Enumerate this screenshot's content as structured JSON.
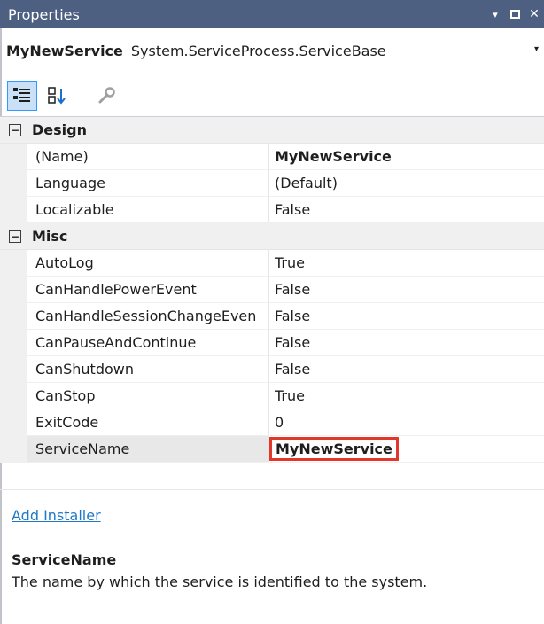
{
  "window": {
    "title": "Properties",
    "controls": {
      "dropdown": "▾",
      "close": "✕"
    }
  },
  "object_selector": {
    "name": "MyNewService",
    "type": "System.ServiceProcess.ServiceBase",
    "dropdown": "▾"
  },
  "toolbar": {
    "buttons": [
      {
        "icon": "categorized-icon",
        "active": true
      },
      {
        "icon": "alphabetical-sort-icon",
        "active": false
      },
      {
        "icon": "property-pages-wrench-icon",
        "active": false
      }
    ]
  },
  "categories": [
    {
      "expander": "−",
      "label": "Design",
      "properties": [
        {
          "name": "(Name)",
          "value": "MyNewService",
          "bold": true
        },
        {
          "name": "Language",
          "value": "(Default)",
          "bold": false
        },
        {
          "name": "Localizable",
          "value": "False",
          "bold": false
        }
      ]
    },
    {
      "expander": "−",
      "label": "Misc",
      "properties": [
        {
          "name": "AutoLog",
          "value": "True",
          "bold": false
        },
        {
          "name": "CanHandlePowerEvent",
          "value": "False",
          "bold": false
        },
        {
          "name": "CanHandleSessionChangeEven",
          "value": "False",
          "bold": false
        },
        {
          "name": "CanPauseAndContinue",
          "value": "False",
          "bold": false
        },
        {
          "name": "CanShutdown",
          "value": "False",
          "bold": false
        },
        {
          "name": "CanStop",
          "value": "True",
          "bold": false
        },
        {
          "name": "ExitCode",
          "value": "0",
          "bold": false
        },
        {
          "name": "ServiceName",
          "value": "MyNewService",
          "bold": true
        }
      ]
    }
  ],
  "commands": {
    "add_installer": "Add Installer"
  },
  "description": {
    "title": "ServiceName",
    "text": "The name by which the service is identified to the system."
  },
  "colors": {
    "titlebar": "#4d6082",
    "highlight_border": "#e0392b",
    "link": "#1e78c8"
  }
}
